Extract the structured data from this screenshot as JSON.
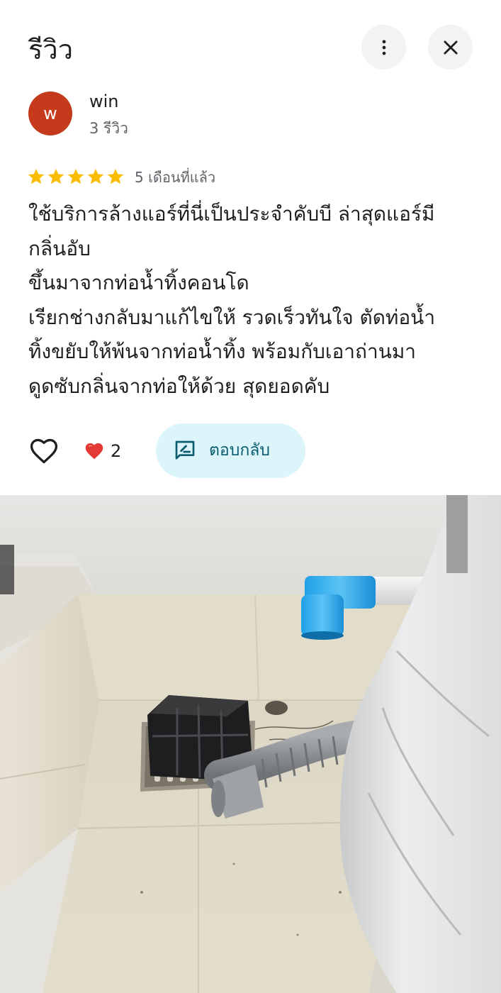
{
  "header": {
    "title": "รีวิว",
    "more_icon": "more-vert-icon",
    "close_icon": "close-icon"
  },
  "reviewer": {
    "initial": "w",
    "name": "win",
    "review_count": "3 รีวิว",
    "avatar_color": "#c5391d"
  },
  "review": {
    "rating": 5,
    "max_rating": 5,
    "star_color": "#fbbc04",
    "time": "5 เดือนที่แล้ว",
    "lines": [
      "ใช้บริการล้างแอร์ที่นี่เป็นประจำคับบี ล่าสุดแอร์มี",
      "กลิ่นอับ",
      "ขึ้นมาจากท่อน้ำทิ้งคอนโด",
      "เรียกช่างกลับมาแก้ไขให้ รวดเร็วทันใจ ตัดท่อน้ำ",
      "ทิ้งขยับให้พ้นจากท่อน้ำทิ้ง พร้อมกับเอาถ่านมา",
      "ดูดซับกลิ่นจากท่อให้ด้วย สุดยอดคับ"
    ]
  },
  "actions": {
    "like_icon": "heart-outline-icon",
    "reaction_icon": "red-heart-icon",
    "like_count": "2",
    "reply_label": "ตอบกลับ",
    "reply_icon": "rate-review-icon",
    "reply_bg": "#dcf5fb"
  },
  "photo": {
    "description_icon": "review-photo"
  }
}
